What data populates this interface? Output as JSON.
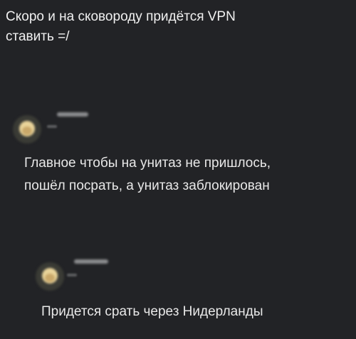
{
  "post": {
    "text_lines": [
      "Скоро и на сковороду придётся VPN",
      "ставить =/"
    ]
  },
  "comments": [
    {
      "avatar_icon": "blurred-avatar-icon",
      "text_lines": [
        "Главное чтобы на унитаз не пришлось,",
        "пошёл посрать, а унитаз заблокирован"
      ]
    },
    {
      "avatar_icon": "blurred-avatar-icon",
      "text_lines": [
        "Придется срать через Нидерланды"
      ]
    }
  ],
  "colors": {
    "background": "#222326",
    "text": "#ececec"
  }
}
